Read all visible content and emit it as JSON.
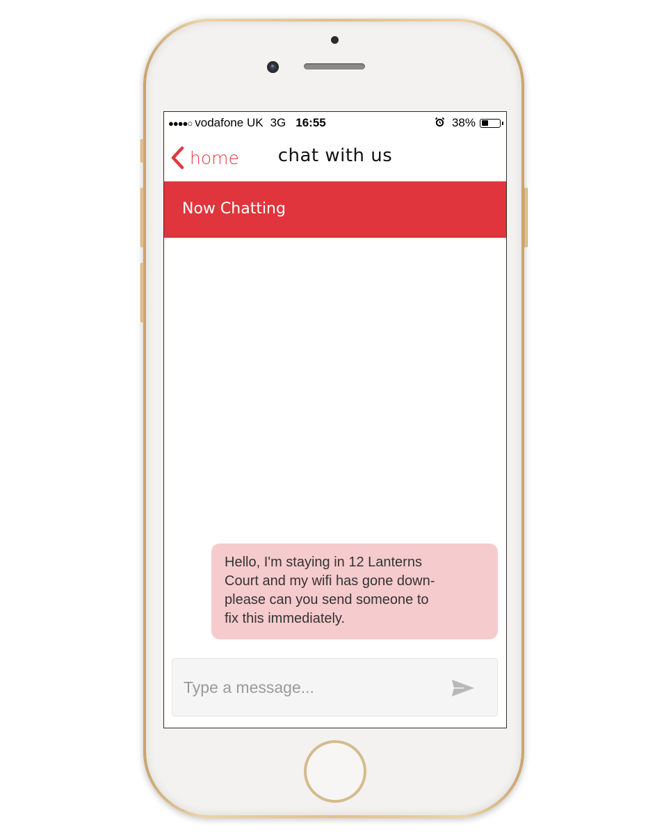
{
  "status_bar": {
    "signal": "●●●●○",
    "carrier": "vodafone UK",
    "network": "3G",
    "time": "16:55",
    "alarm_icon": "alarm-clock-icon",
    "battery_percent": "38%",
    "battery_level": 0.38
  },
  "nav": {
    "back_label": "home",
    "back_icon": "chevron-left-icon",
    "title": "chat with us",
    "accent_color": "#e0393e"
  },
  "banner": {
    "title": "Now Chatting",
    "color": "#e0353c"
  },
  "messages": [
    {
      "text": "Hello, I'm staying in 12 Lanterns\nCourt and my wifi has gone down-\nplease can you send someone to\nfix this immediately.",
      "bubble_color": "#f6cbcd"
    }
  ],
  "composer": {
    "placeholder": "Type a message...",
    "value": "",
    "send_icon": "send-icon"
  }
}
